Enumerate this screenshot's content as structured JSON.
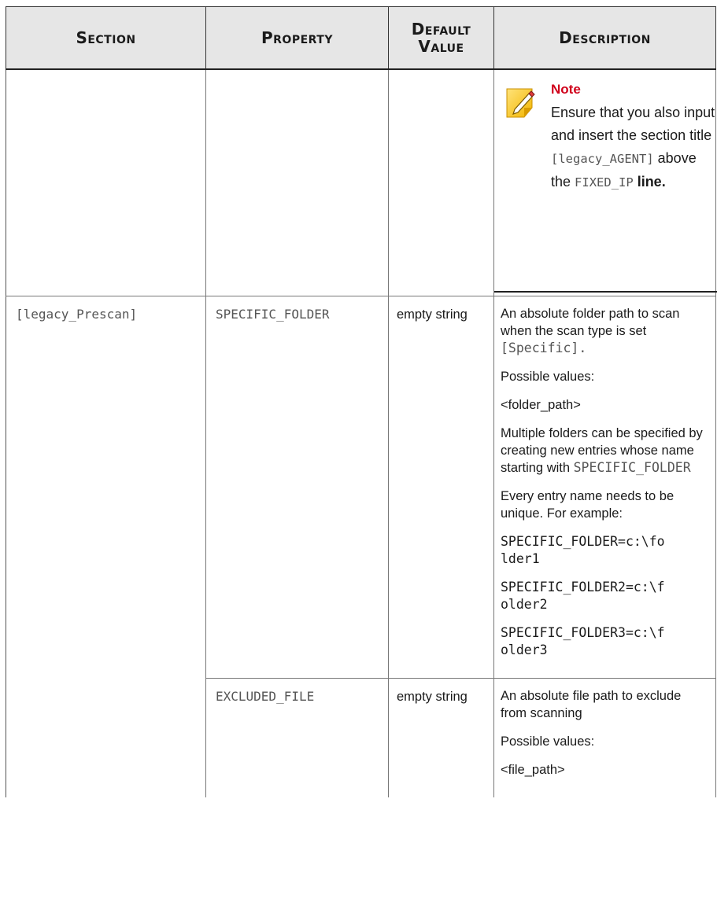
{
  "headers": {
    "section": "Section",
    "property": "Property",
    "default_value": "Default Value",
    "description": "Description"
  },
  "note": {
    "title": "Note",
    "text_1": "Ensure that you also input and insert the section title ",
    "code_1": "[legacy_AGENT]",
    "text_2": " above the ",
    "code_2": "FIXED_IP",
    "text_3": " line."
  },
  "rows": [
    {
      "section": "[legacy_Prescan]",
      "property": "SPECIFIC_FOLDER",
      "default_value": "empty string",
      "desc_1a": "An absolute folder path to scan when the scan type is set ",
      "desc_1b": "[Specific].",
      "desc_2": "Possible values:",
      "desc_3": "<folder_path>",
      "desc_4a": "Multiple folders can be specified by creating new entries whose name starting with ",
      "desc_4b": "SPECIFIC_FOLDER",
      "desc_5": "Every entry name needs to be unique. For example:",
      "example_1": "SPECIFIC_FOLDER=c:\\fo lder1",
      "example_2": "SPECIFIC_FOLDER2=c:\\f older2",
      "example_3": "SPECIFIC_FOLDER3=c:\\f older3"
    },
    {
      "property": "EXCLUDED_FILE",
      "default_value": "empty string",
      "desc_1": "An absolute file path to exclude from scanning",
      "desc_2": "Possible values:",
      "desc_3": "<file_path>"
    }
  ]
}
